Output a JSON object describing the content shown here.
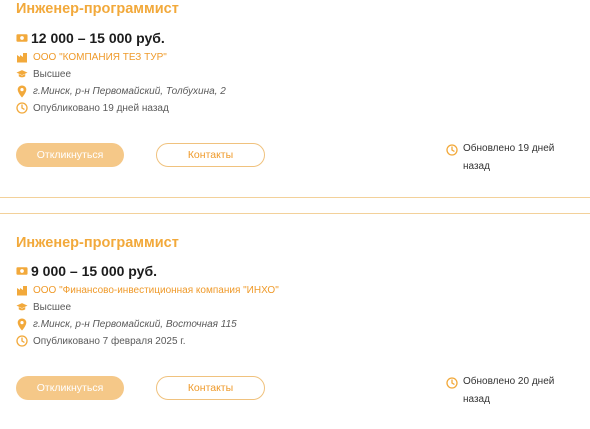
{
  "colors": {
    "accent": "#f2a93b",
    "button_fill": "#f5c888",
    "divider": "#f3d19a"
  },
  "vacancies": [
    {
      "title": "Инженер-программист",
      "salary": "12 000 – 15 000 руб.",
      "company": "ООО \"КОМПАНИЯ ТЕЗ ТУР\"",
      "education": "Высшее",
      "address": "г.Минск, р-н Первомайский, Толбухина, 2",
      "published": "Опубликовано 19 дней назад",
      "respond_label": "Откликнуться",
      "contacts_label": "Контакты",
      "updated": "Обновлено 19 дней назад",
      "icons": [
        "money-icon",
        "building-icon",
        "graduation-cap-icon",
        "location-pin-icon",
        "clock-icon"
      ]
    },
    {
      "title": "Инженер-программист",
      "salary": "9 000 – 15 000 руб.",
      "company": "ООО \"Финансово-инвестиционная компания \"ИНХО\"",
      "education": "Высшее",
      "address": "г.Минск, р-н Первомайский, Восточная 115",
      "published": "Опубликовано 7 февраля 2025 г.",
      "respond_label": "Откликнуться",
      "contacts_label": "Контакты",
      "updated": "Обновлено 20 дней назад",
      "icons": [
        "money-icon",
        "building-icon",
        "graduation-cap-icon",
        "location-pin-icon",
        "clock-icon"
      ]
    }
  ]
}
